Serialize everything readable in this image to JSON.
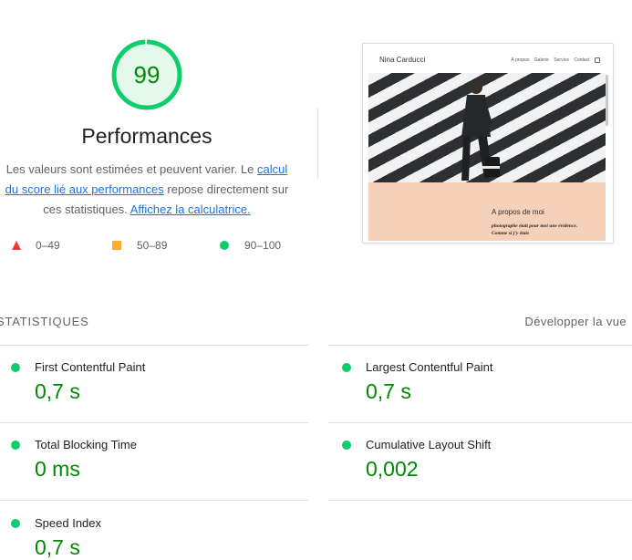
{
  "gauge": {
    "score": "99",
    "score_value": 99,
    "title": "Performances",
    "color": "#0cce6b",
    "fill_color": "#e5f8ec",
    "text_color": "#008800"
  },
  "description": {
    "text_before": "Les valeurs sont estimées et peuvent varier. Le ",
    "link1": "calcul du score lié aux performances",
    "text_middle": " repose directement sur ces statistiques. ",
    "link2": "Affichez la calculatrice."
  },
  "legend": {
    "items": [
      {
        "label": "0–49",
        "icon": "red-triangle-icon",
        "color": "#ff3333"
      },
      {
        "label": "50–89",
        "icon": "orange-square-icon",
        "color": "#ffaa33"
      },
      {
        "label": "90–100",
        "icon": "green-circle-icon",
        "color": "#0cce6b"
      }
    ]
  },
  "screenshot": {
    "brand": "Nina Carducci",
    "menu": [
      "À propos",
      "Galerie",
      "Service",
      "Contact"
    ],
    "about_title": "A propos de moi",
    "about_text": "photographe était pour moi une évidence. Comme si j'y étais",
    "about_color": "#f5d1b9"
  },
  "metrics": {
    "header": "STATISTIQUES",
    "toggle_label": "Développer la vue",
    "items": [
      {
        "name": "First Contentful Paint",
        "value": "0,7 s",
        "status_icon": "green-circle-icon"
      },
      {
        "name": "Largest Contentful Paint",
        "value": "0,7 s",
        "status_icon": "green-circle-icon"
      },
      {
        "name": "Total Blocking Time",
        "value": "0 ms",
        "status_icon": "green-circle-icon"
      },
      {
        "name": "Cumulative Layout Shift",
        "value": "0,002",
        "status_icon": "green-circle-icon"
      },
      {
        "name": "Speed Index",
        "value": "0,7 s",
        "status_icon": "green-circle-icon"
      }
    ]
  }
}
